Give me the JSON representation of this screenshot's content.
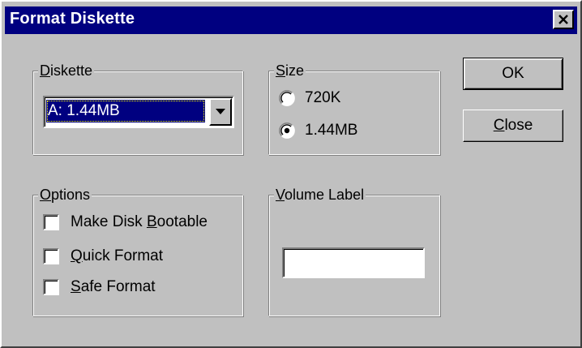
{
  "window": {
    "title": "Format Diskette",
    "close_glyph": "✕"
  },
  "diskette": {
    "label_mnemonic": "D",
    "label_rest": "iskette",
    "selected_drive": "A: 1.44MB"
  },
  "size": {
    "label_mnemonic": "S",
    "label_rest": "ize",
    "options": [
      {
        "label": "720K",
        "selected": false
      },
      {
        "label": "1.44MB",
        "selected": true
      }
    ]
  },
  "options": {
    "label_mnemonic": "O",
    "label_rest": "ptions",
    "make_bootable": {
      "pre": "Make Disk ",
      "mnemonic": "B",
      "post": "ootable",
      "checked": false
    },
    "quick_format": {
      "pre": "",
      "mnemonic": "Q",
      "post": "uick Format",
      "checked": false
    },
    "safe_format": {
      "pre": "",
      "mnemonic": "S",
      "post": "afe Format",
      "checked": false
    }
  },
  "volume_label": {
    "label_mnemonic": "V",
    "label_rest": "olume Label",
    "value": ""
  },
  "buttons": {
    "ok_label": "OK",
    "close_mnemonic": "C",
    "close_rest": "lose"
  },
  "colors": {
    "titlebar": "#000080",
    "face": "#c0c0c0",
    "selection": "#000080"
  }
}
